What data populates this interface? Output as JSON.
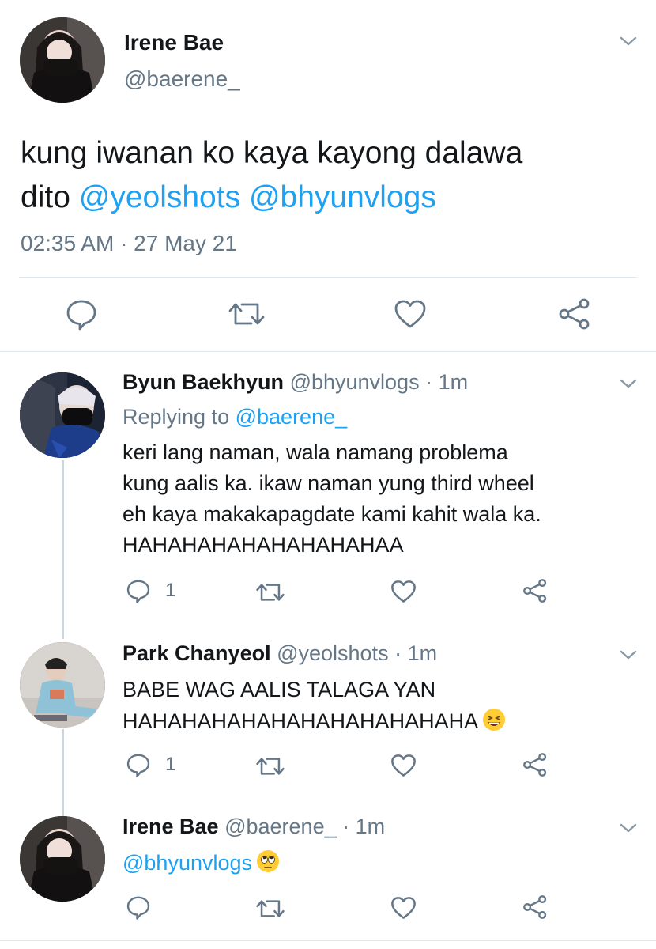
{
  "main_tweet": {
    "name": "Irene Bae",
    "handle": "@baerene_",
    "text_prefix": "kung iwanan ko kaya kayong dalawa",
    "text_line2_prefix": "dito",
    "mention1": "@yeolshots",
    "mention2": "@bhyunvlogs",
    "timestamp": "02:35 AM · 27 May 21"
  },
  "replies": [
    {
      "name": "Byun Baekhyun",
      "handle": "@bhyunvlogs",
      "time": "· 1m",
      "replying_prefix": "Replying to",
      "replying_to": "@baerene_",
      "lines": [
        "keri lang naman, wala namang problema",
        "kung aalis ka. ikaw naman yung third wheel",
        "eh kaya makakapagdate kami kahit wala ka.",
        "HAHAHAHAHAHAHAHAHAA"
      ],
      "reply_count": "1"
    },
    {
      "name": "Park Chanyeol",
      "handle": "@yeolshots",
      "time": "· 1m",
      "lines": [
        "BABE WAG AALIS TALAGA YAN",
        "HAHAHAHAHAHAHAHAHAHAHAHA"
      ],
      "emoji": "grinning-squinting-face",
      "reply_count": "1"
    },
    {
      "name": "Irene Bae",
      "handle": "@baerene_",
      "time": "· 1m",
      "mention": "@bhyunvlogs",
      "emoji": "face-with-rolling-eyes"
    }
  ],
  "colors": {
    "link": "#1da1f2",
    "secondary_text": "#657786",
    "divider": "#e1e8ed"
  }
}
